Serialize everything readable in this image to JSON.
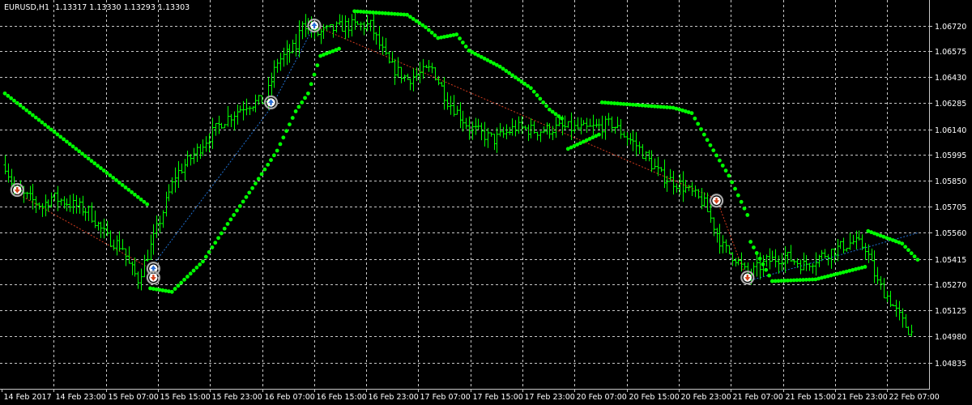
{
  "window": {
    "title": "EURUSD,H1",
    "ohlc": "1.13317 1.13330 1.13293 1.13303"
  },
  "colors": {
    "background": "#000000",
    "grid": "#c8c8c8",
    "axis": "#c8c8c8",
    "text": "#ffffff",
    "bars": "#00ff00",
    "sar": "#00ff00",
    "zigzag_up": "#1e6fd0",
    "zigzag_down": "#d23b1e",
    "marker": "#a9a9a9"
  },
  "chart_data": {
    "type": "line",
    "symbol": "EURUSD",
    "timeframe": "H1",
    "x_ticks": [
      "14 Feb 2017",
      "14 Feb 23:00",
      "15 Feb 07:00",
      "15 Feb 15:00",
      "15 Feb 23:00",
      "16 Feb 07:00",
      "16 Feb 15:00",
      "16 Feb 23:00",
      "17 Feb 07:00",
      "17 Feb 15:00",
      "17 Feb 23:00",
      "20 Feb 07:00",
      "20 Feb 15:00",
      "20 Feb 23:00",
      "21 Feb 07:00",
      "21 Feb 15:00",
      "21 Feb 23:00",
      "22 Feb 07:00"
    ],
    "y_ticks": [
      1.0672,
      1.06575,
      1.0643,
      1.06285,
      1.0614,
      1.05995,
      1.0585,
      1.05705,
      1.0556,
      1.05415,
      1.0527,
      1.05125,
      1.0498,
      1.04835
    ],
    "ylim": [
      1.0476,
      1.0682
    ],
    "grid": true,
    "series": [
      {
        "kind": "price_bars",
        "anchors": [
          [
            0,
            1.0594
          ],
          [
            3,
            1.058
          ],
          [
            6,
            1.0577
          ],
          [
            12,
            1.0571
          ],
          [
            15,
            1.0576
          ],
          [
            20,
            1.0573
          ],
          [
            27,
            1.0568
          ],
          [
            33,
            1.0553
          ],
          [
            38,
            1.0548
          ],
          [
            40,
            1.0538
          ],
          [
            43,
            1.053
          ],
          [
            48,
            1.0553
          ],
          [
            55,
            1.0588
          ],
          [
            62,
            1.0602
          ],
          [
            70,
            1.0618
          ],
          [
            78,
            1.0628
          ],
          [
            84,
            1.063
          ],
          [
            88,
            1.0652
          ],
          [
            94,
            1.066
          ],
          [
            96,
            1.0675
          ],
          [
            100,
            1.0667
          ],
          [
            110,
            1.0672
          ],
          [
            118,
            1.0672
          ],
          [
            124,
            1.065
          ],
          [
            130,
            1.0642
          ],
          [
            138,
            1.0648
          ],
          [
            143,
            1.063
          ],
          [
            150,
            1.0615
          ],
          [
            158,
            1.0608
          ],
          [
            165,
            1.0615
          ],
          [
            172,
            1.0613
          ],
          [
            180,
            1.0615
          ],
          [
            188,
            1.0614
          ],
          [
            196,
            1.0617
          ],
          [
            204,
            1.0605
          ],
          [
            212,
            1.0588
          ],
          [
            218,
            1.0583
          ],
          [
            222,
            1.0578
          ],
          [
            226,
            1.0572
          ],
          [
            232,
            1.0548
          ],
          [
            236,
            1.0542
          ],
          [
            240,
            1.0532
          ],
          [
            246,
            1.054
          ],
          [
            252,
            1.0543
          ],
          [
            258,
            1.0538
          ],
          [
            266,
            1.0545
          ],
          [
            274,
            1.0551
          ],
          [
            278,
            1.0548
          ],
          [
            282,
            1.0528
          ],
          [
            286,
            1.0518
          ],
          [
            290,
            1.0506
          ],
          [
            293,
            1.05
          ]
        ]
      },
      {
        "kind": "parabolic_sar",
        "segments": [
          [
            [
              0,
              1.0634
            ],
            [
              46,
              1.0572
            ]
          ],
          [
            [
              47,
              1.0525
            ],
            [
              54,
              1.0523
            ],
            [
              64,
              1.054
            ],
            [
              72,
              1.0561
            ],
            [
              80,
              1.0581
            ],
            [
              88,
              1.0602
            ],
            [
              94,
              1.0624
            ],
            [
              98,
              1.0634
            ],
            [
              102,
              1.0655
            ],
            [
              108,
              1.0659
            ]
          ],
          [
            [
              113,
              1.068
            ],
            [
              130,
              1.0678
            ],
            [
              136,
              1.0671
            ],
            [
              140,
              1.0665
            ],
            [
              146,
              1.0667
            ],
            [
              150,
              1.0658
            ],
            [
              160,
              1.0649
            ],
            [
              170,
              1.0637
            ],
            [
              176,
              1.0625
            ],
            [
              180,
              1.062
            ]
          ],
          [
            [
              182,
              1.0603
            ],
            [
              192,
              1.0611
            ]
          ],
          [
            [
              193,
              1.0629
            ],
            [
              216,
              1.0626
            ],
            [
              222,
              1.0623
            ],
            [
              228,
              1.0605
            ],
            [
              234,
              1.0588
            ],
            [
              240,
              1.0566
            ]
          ],
          [
            [
              241,
              1.0551
            ],
            [
              248,
              1.0529
            ],
            [
              262,
              1.053
            ],
            [
              278,
              1.0537
            ]
          ],
          [
            [
              279,
              1.0557
            ],
            [
              290,
              1.055
            ],
            [
              295,
              1.0541
            ]
          ]
        ]
      },
      {
        "kind": "zigzag",
        "points": [
          [
            4,
            1.0578
          ],
          [
            47,
            1.0536
          ],
          [
            86,
            1.0626
          ],
          [
            100,
            1.0672
          ],
          [
            230,
            1.0575
          ],
          [
            240,
            1.0529
          ],
          [
            295,
            1.0556
          ]
        ]
      }
    ],
    "markers": [
      {
        "x": 4,
        "y": 1.058,
        "dir": "down"
      },
      {
        "x": 48,
        "y": 1.0536,
        "dir": "up"
      },
      {
        "x": 48,
        "y": 1.0531,
        "dir": "down"
      },
      {
        "x": 86,
        "y": 1.0629,
        "dir": "up"
      },
      {
        "x": 100,
        "y": 1.0672,
        "dir": "up"
      },
      {
        "x": 230,
        "y": 1.0574,
        "dir": "down"
      },
      {
        "x": 240,
        "y": 1.0531,
        "dir": "down"
      }
    ]
  }
}
